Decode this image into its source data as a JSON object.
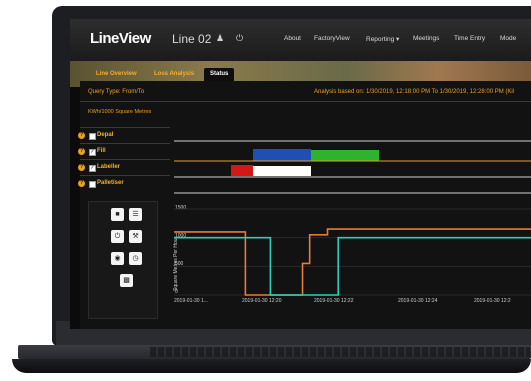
{
  "app": {
    "logo": "LineView",
    "line_name": "Line 02",
    "user_icon": "user-icon",
    "logout_icon": "power-icon",
    "nav": [
      "About",
      "FactoryView",
      "Reporting",
      "Meetings",
      "Time Entry",
      "Mode"
    ],
    "reporting_caret": "▾"
  },
  "tabs": [
    "Line Overview",
    "Loss Analysis",
    "Status"
  ],
  "active_tab": "Status",
  "query_type": "Query Type: From/To",
  "analysis_text": "Analysis based on: 1/30/2019, 12:18:00 PM To 1/30/2019, 12:28:00 PM (Kil",
  "unit_label": "KWh/1000 Square Metres",
  "rows": [
    {
      "label": "Depal",
      "checked": false
    },
    {
      "label": "Fill",
      "checked": true
    },
    {
      "label": "Labeller",
      "checked": true
    },
    {
      "label": "Palletiser",
      "checked": false
    }
  ],
  "row_dot_text": "?",
  "colors": {
    "orange": "#e8a020",
    "blue": "#1f4fb5",
    "green": "#2db32d",
    "red": "#d41818",
    "white": "#ffffff",
    "teal": "#2ad0b8",
    "line_orange": "#e87a3a"
  },
  "controls": [
    "chat-icon",
    "bars-icon",
    "power-icon",
    "wrench-icon",
    "gauge-icon",
    "timer-icon",
    "chart-icon"
  ],
  "chart_data": {
    "type": "line",
    "ylabel": "Square Metres Per Hour",
    "y_ticks": [
      "1500",
      "1000",
      "500",
      "0"
    ],
    "ylim": [
      0,
      1500
    ],
    "x_ticks": [
      "2019-01-30 1...",
      "2019-01-30 12:20",
      "2019-01-30 12:22",
      "2019-01-30 12:24",
      "2019-01-30 12:2"
    ],
    "xlim": [
      0,
      10
    ],
    "series": [
      {
        "color": "#e87a3a",
        "x": [
          0,
          2.0,
          2.0,
          3.6,
          3.6,
          3.8,
          3.8,
          4.3,
          4.3,
          10
        ],
        "y": [
          1100,
          1100,
          0,
          0,
          550,
          550,
          1050,
          1050,
          1150,
          1150
        ]
      },
      {
        "color": "#2ad0b8",
        "x": [
          0,
          2.7,
          2.7,
          4.6,
          4.6,
          10
        ],
        "y": [
          1000,
          1000,
          0,
          0,
          1000,
          1000
        ]
      }
    ]
  }
}
